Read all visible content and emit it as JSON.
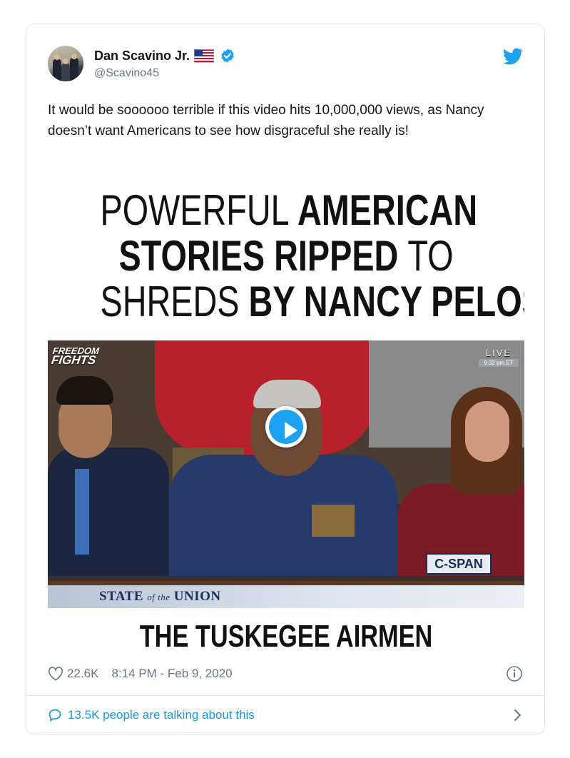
{
  "author": {
    "name": "Dan Scavino Jr.",
    "handle": "@Scavino45",
    "badges": [
      "us-flag-icon",
      "verified-icon"
    ]
  },
  "tweet": {
    "text": "It would be soooooo terrible if this video hits 10,000,000 views, as Nancy doesn’t want Americans to see how disgraceful she really is!"
  },
  "media": {
    "headline_lines": [
      [
        {
          "text": "POWERFUL ",
          "weight": "thin"
        },
        {
          "text": "AMERICAN",
          "weight": "bold"
        }
      ],
      [
        {
          "text": "STORIES RIPPED ",
          "weight": "bold"
        },
        {
          "text": "TO",
          "weight": "thin"
        }
      ],
      [
        {
          "text": "SHREDS ",
          "weight": "thin"
        },
        {
          "text": "BY NANCY PELOSI",
          "weight": "bold"
        }
      ]
    ],
    "video": {
      "logo_line1": "FREEDOM",
      "logo_line2": "FIGHTS",
      "live_label": "LIVE",
      "live_time": "9:32 pm ET",
      "network": "C-SPAN",
      "banner_pre": "STATE ",
      "banner_of": "of the",
      "banner_post": " UNION"
    },
    "caption": "THE TUSKEGEE AIRMEN"
  },
  "meta": {
    "likes": "22.6K",
    "timestamp": "8:14 PM - Feb 9, 2020"
  },
  "footer": {
    "talking": "13.5K people are talking about this"
  },
  "colors": {
    "twitter_blue": "#1da1f2",
    "link_blue": "#1b95e0",
    "muted": "#657786",
    "border": "#e1e8ed"
  }
}
